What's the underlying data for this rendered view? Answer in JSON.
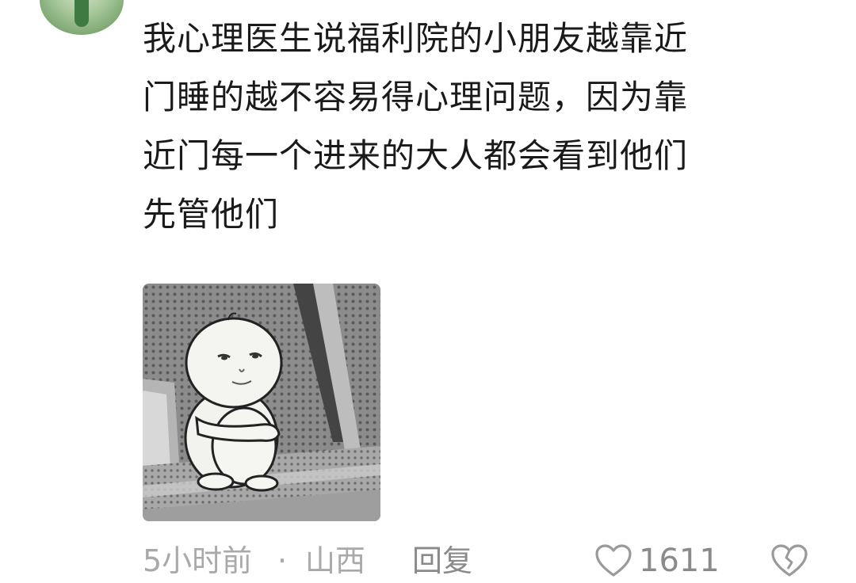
{
  "comment": {
    "lines": [
      "我心理医生说福利院的小朋友越靠近",
      "门睡的越不容易得心理问题，因为靠",
      "近门每一个进来的大人都会看到他们",
      "先管他们"
    ]
  },
  "meta": {
    "time": "5小时前",
    "separator": "·",
    "location": "山西",
    "reply_label": "回复",
    "like_count": "1611"
  },
  "icons": {
    "like": "heart-icon",
    "dislike": "broken-heart-icon"
  }
}
